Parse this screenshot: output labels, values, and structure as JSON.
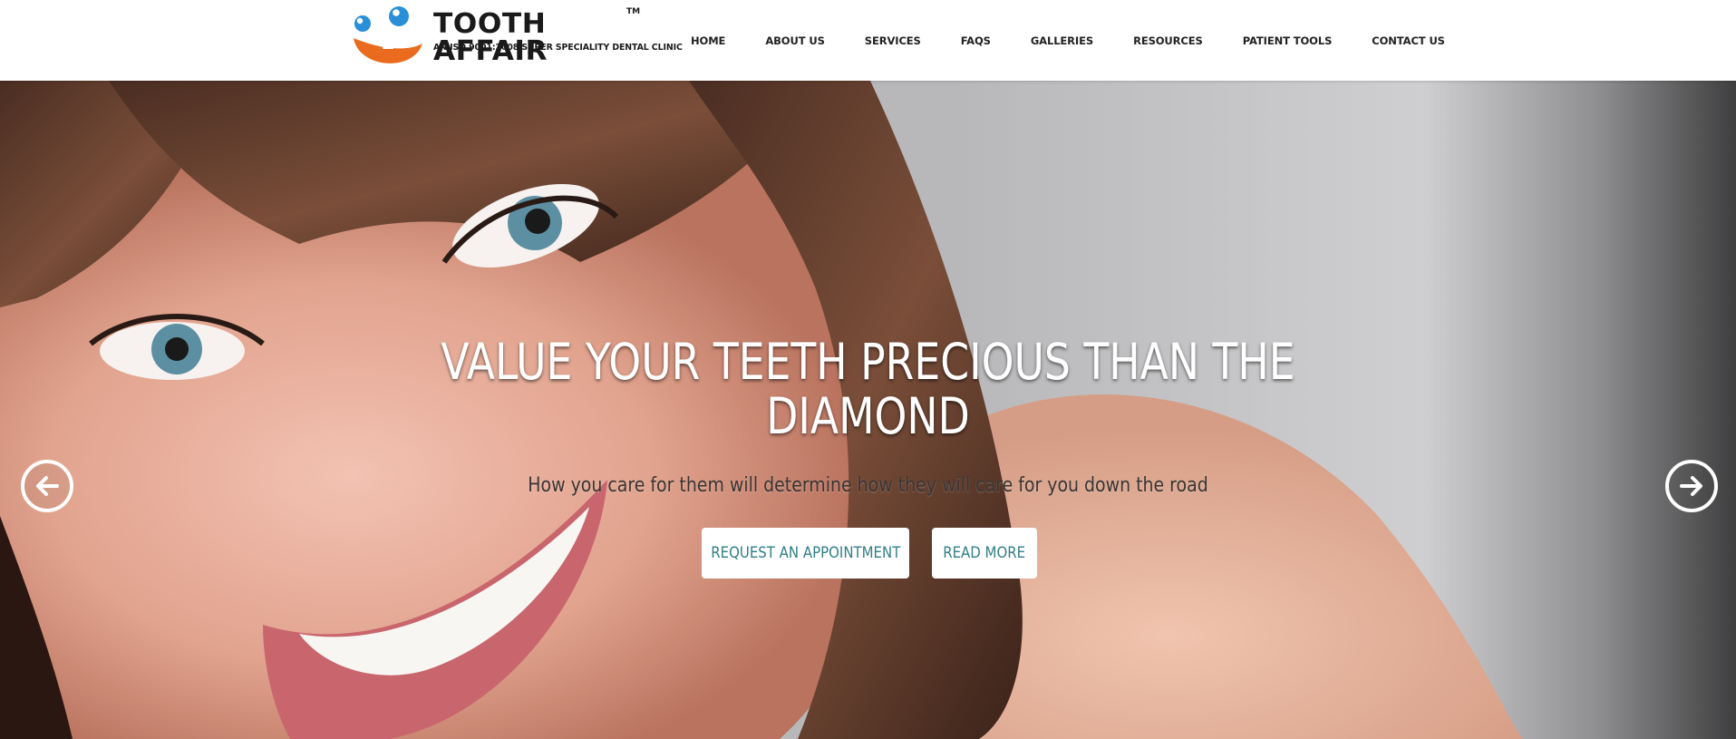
{
  "header": {
    "logo": {
      "name": "TOOTH AFFAIR",
      "trademark": "TM",
      "tagline": "AN ISO 9001:2008 SUPER SPECIALITY DENTAL CLINIC",
      "colors": {
        "orange": "#ea6b1e",
        "blue": "#2a8fd6"
      }
    },
    "nav": [
      {
        "label": "HOME"
      },
      {
        "label": "ABOUT US"
      },
      {
        "label": "SERVICES"
      },
      {
        "label": "FAQS"
      },
      {
        "label": "GALLERIES"
      },
      {
        "label": "RESOURCES"
      },
      {
        "label": "PATIENT TOOLS"
      },
      {
        "label": "CONTACT US"
      }
    ]
  },
  "hero": {
    "title_line1": "VALUE YOUR TEETH PRECIOUS THAN THE",
    "title_line2": "DIAMOND",
    "subtitle": "How you care for them will determine how they will care for you down the road",
    "buttons": {
      "appointment": "REQUEST AN APPOINTMENT",
      "read_more": "READ MORE"
    },
    "accent_color": "#2f7f86",
    "arrows": {
      "prev_icon": "arrow-left-circle-icon",
      "next_icon": "arrow-right-circle-icon"
    }
  }
}
